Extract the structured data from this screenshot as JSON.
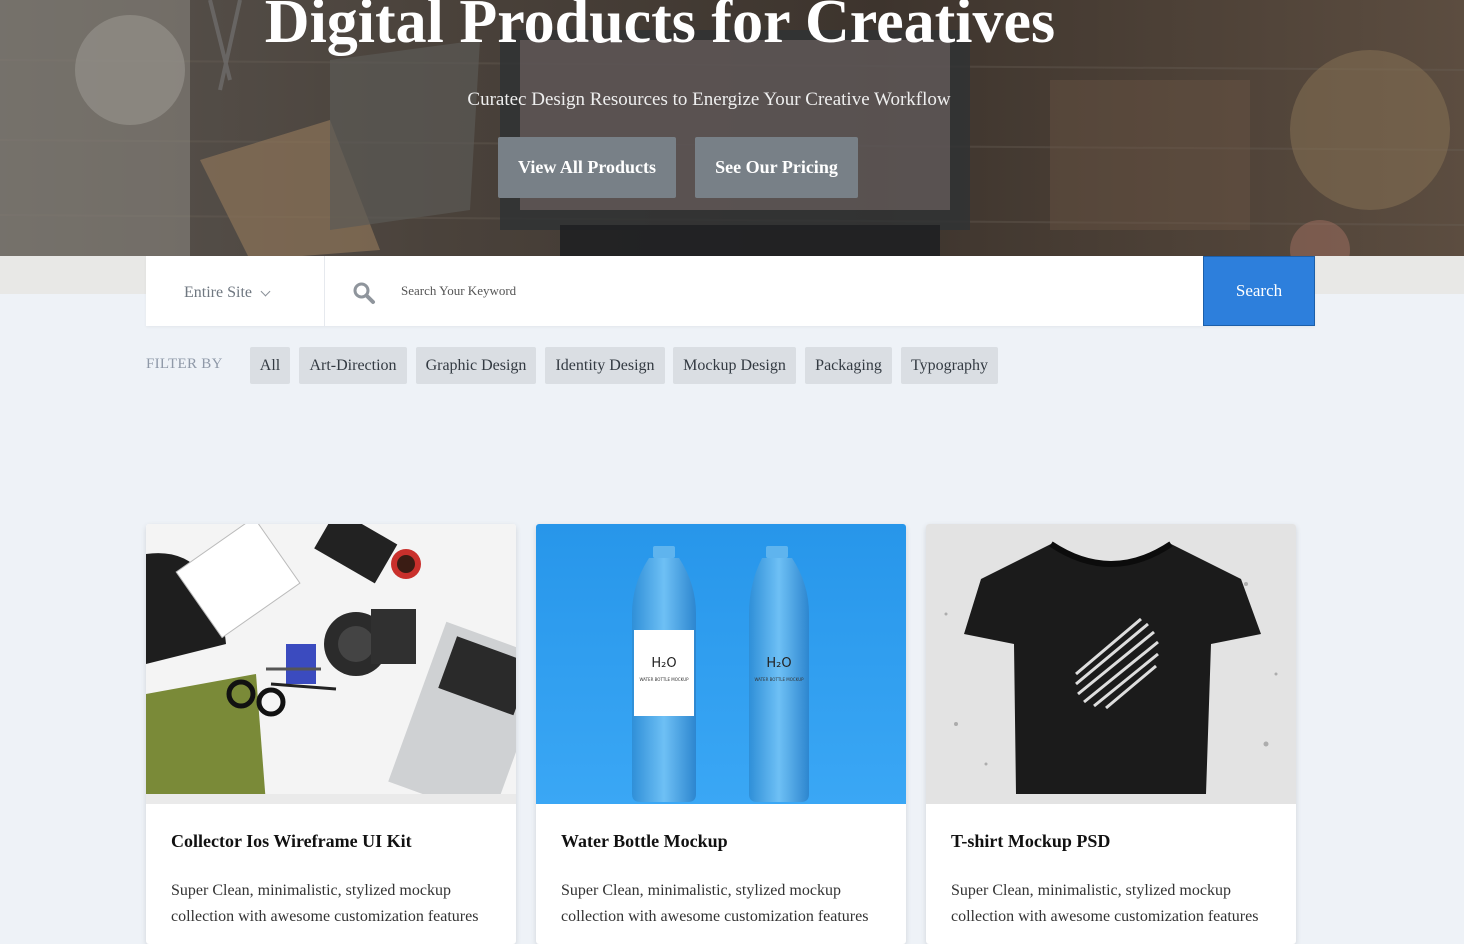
{
  "hero": {
    "title": "Digital Products for Creatives",
    "subtitle": "Curatec Design Resources to Energize Your Creative Workflow",
    "buttons": [
      "View All Products",
      "See Our Pricing"
    ]
  },
  "search": {
    "scope": "Entire Site",
    "placeholder": "Search Your Keyword",
    "button": "Search"
  },
  "filter": {
    "label": "FILTER BY",
    "chips": [
      "All",
      "Art-Direction",
      "Graphic Design",
      "Identity Design",
      "Mockup Design",
      "Packaging",
      "Typography"
    ]
  },
  "products": [
    {
      "title": "Collector Ios Wireframe UI Kit",
      "desc": "Super Clean, minimalistic, stylized mockup collection with awesome customization features"
    },
    {
      "title": "Water Bottle Mockup",
      "desc": "Super Clean, minimalistic, stylized mockup collection with awesome customization features",
      "bottle_label": "H₂O",
      "bottle_sub": "WATER BOTTLE MOCKUP"
    },
    {
      "title": "T-shirt Mockup PSD",
      "desc": "Super Clean, minimalistic, stylized mockup collection with awesome customization features"
    }
  ],
  "colors": {
    "accent": "#2d7fdc",
    "hero_button": "#788087",
    "chip": "#dadee3",
    "page_bg": "#eef2f7"
  }
}
